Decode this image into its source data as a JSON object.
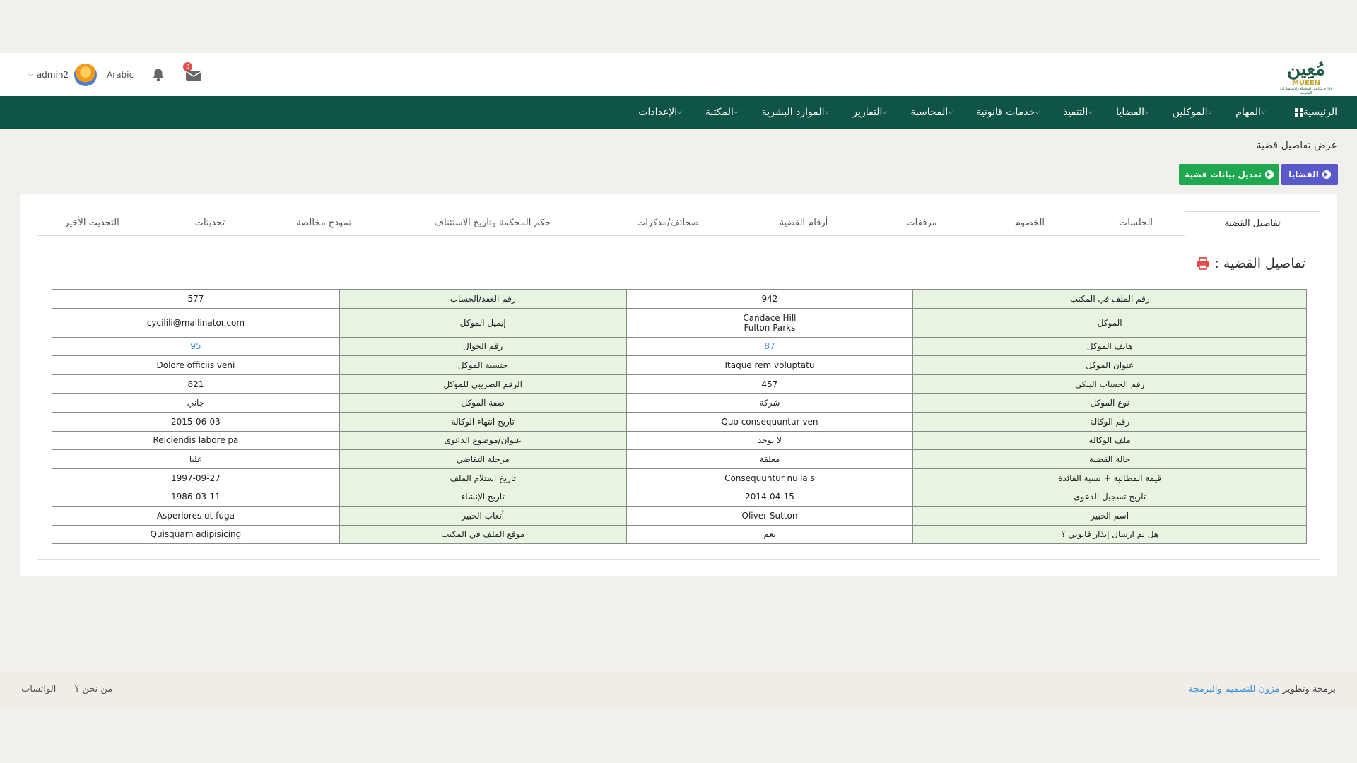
{
  "header": {
    "logo_ar": "مُعِين",
    "logo_en": "MUEEN",
    "logo_tagline": "لإدارة مكاتب المحاماة والاستشارات القانونية",
    "user": "admin2",
    "language": "Arabic",
    "mail_badge": "0"
  },
  "nav": [
    {
      "label": "الرئيسية"
    },
    {
      "label": "المهام"
    },
    {
      "label": "الموكلين"
    },
    {
      "label": "القضايا"
    },
    {
      "label": "التنفيذ"
    },
    {
      "label": "خدمات قانونية"
    },
    {
      "label": "المحاسبة"
    },
    {
      "label": "التقارير"
    },
    {
      "label": "الموارد البشرية"
    },
    {
      "label": "المكتبة"
    },
    {
      "label": "الإعدادات"
    }
  ],
  "breadcrumb": "عرض تفاصيل قضية",
  "buttons": {
    "cases": "القضايا",
    "edit": "تعديل بيانات قضية"
  },
  "tabs": [
    "تفاصيل القضية",
    "الجلسات",
    "الخصوم",
    "مرفقات",
    "أرقام القضية",
    "صحائف/مذكرات",
    "حكم المحكمة وتاريخ الاستئناف",
    "نموذج مخالصة",
    "تحديثات",
    "التحديث الأخير"
  ],
  "panel_title": "تفاصيل القضية :",
  "rows": [
    {
      "l1": "رقم الملف في المكتب",
      "v1": "942",
      "l2": "رقم العقد/الحساب",
      "v2": "577"
    },
    {
      "l1": "الموكل",
      "v1a": "Candace Hill",
      "v1b": "Fulton Parks",
      "l2": "إيميل الموكل",
      "v2": "cycilili@mailinator.com"
    },
    {
      "l1": "هاتف الموكل",
      "v1": "87",
      "l2": "رقم الجوال",
      "v2": "95"
    },
    {
      "l1": "عنوان الموكل",
      "v1": "Itaque rem voluptatu",
      "l2": "جنسية الموكل",
      "v2": "Dolore officiis veni"
    },
    {
      "l1": "رقم الحساب البنكي",
      "v1": "457",
      "l2": "الرقم الضريبي للموكل",
      "v2": "821"
    },
    {
      "l1": "نوع الموكل",
      "v1": "شركة",
      "l2": "صفة الموكل",
      "v2": "جاني"
    },
    {
      "l1": "رقم الوكالة",
      "v1": "Quo consequuntur ven",
      "l2": "تاريخ انتهاء الوكالة",
      "v2": "2015-06-03"
    },
    {
      "l1": "ملف الوكالة",
      "v1": "لا يوجد",
      "l2": "عنوان/موضوع الدعوى",
      "v2": "Reiciendis labore pa"
    },
    {
      "l1": "حالة القضية",
      "v1": "معلقة",
      "l2": "مرحلة التقاضي",
      "v2": "عليا"
    },
    {
      "l1": "قيمة المطالبة + نسبة الفائدة",
      "v1": "Consequuntur nulla s",
      "l2": "تاريخ استلام الملف",
      "v2": "1997-09-27"
    },
    {
      "l1": "تاريخ تسجيل الدعوى",
      "v1": "2014-04-15",
      "l2": "تاريخ الإنشاء",
      "v2": "1986-03-11"
    },
    {
      "l1": "اسم الخبير",
      "v1": "Oliver Sutton",
      "l2": "أتعاب الخبير",
      "v2": "Asperiores ut fuga"
    },
    {
      "l1": "هل تم ارسال إنذار قانوني ؟",
      "v1": "نعم",
      "l2": "موقع الملف في المكتب",
      "v2": "Quisquam adipisicing"
    }
  ],
  "footer": {
    "credit_prefix": "برمجة وتطوير",
    "credit_link": "مزون للتصميم والبرمجة",
    "about": "من نحن ؟",
    "whatsapp": "الواتساب"
  },
  "colors": {
    "nav_bg": "#0f5444",
    "label_bg": "#e6f4e1",
    "btn_cases": "#5a59c9",
    "btn_edit": "#1fa84f",
    "link": "#3d8fde",
    "printer": "#e34a4a"
  }
}
